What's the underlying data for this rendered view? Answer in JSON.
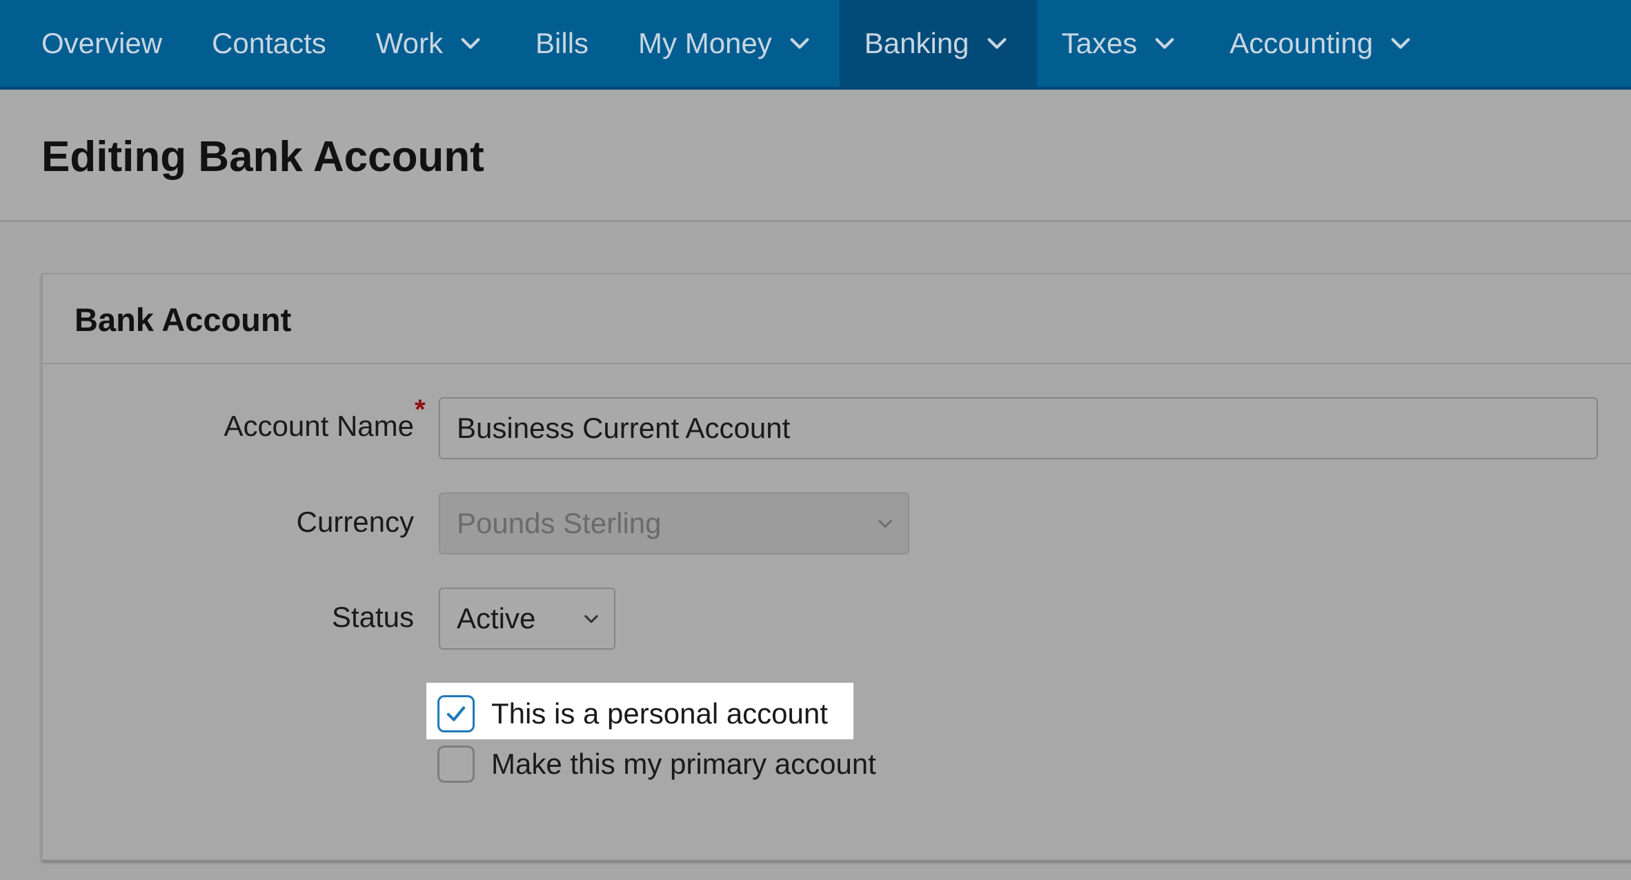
{
  "nav": {
    "items": [
      {
        "label": "Overview",
        "has_dropdown": false,
        "active": false
      },
      {
        "label": "Contacts",
        "has_dropdown": false,
        "active": false
      },
      {
        "label": "Work",
        "has_dropdown": true,
        "active": false
      },
      {
        "label": "Bills",
        "has_dropdown": false,
        "active": false
      },
      {
        "label": "My Money",
        "has_dropdown": true,
        "active": false
      },
      {
        "label": "Banking",
        "has_dropdown": true,
        "active": true
      },
      {
        "label": "Taxes",
        "has_dropdown": true,
        "active": false
      },
      {
        "label": "Accounting",
        "has_dropdown": true,
        "active": false
      }
    ]
  },
  "page": {
    "title": "Editing Bank Account"
  },
  "card": {
    "title": "Bank Account",
    "account_name": {
      "label": "Account Name",
      "required_marker": "*",
      "value": "Business Current Account"
    },
    "currency": {
      "label": "Currency",
      "value": "Pounds Sterling",
      "disabled": true
    },
    "status": {
      "label": "Status",
      "value": "Active"
    },
    "checkboxes": [
      {
        "label": "This is a personal account",
        "checked": true,
        "highlighted": true
      },
      {
        "label": "Make this my primary account",
        "checked": false,
        "highlighted": false
      }
    ]
  },
  "colors": {
    "nav_bg": "#025d91",
    "nav_active_bg": "#024a78",
    "checkbox_accent": "#1d7ab8",
    "required": "#8f0e0e"
  }
}
